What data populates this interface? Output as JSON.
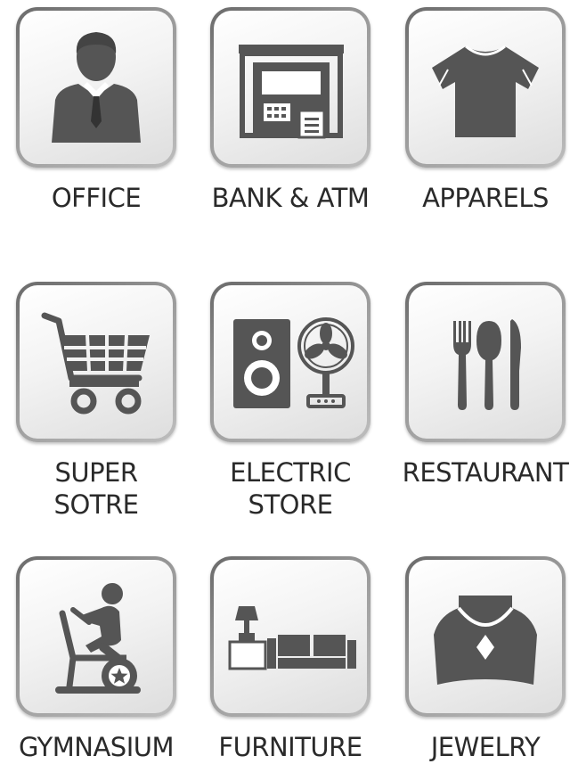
{
  "icons": [
    {
      "label": "OFFICE",
      "icon": "businessman-icon"
    },
    {
      "label": "BANK & ATM",
      "icon": "atm-icon"
    },
    {
      "label": "APPARELS",
      "icon": "tshirt-icon"
    },
    {
      "label_lines": [
        "SUPER",
        "SOTRE"
      ],
      "icon": "shopping-cart-icon"
    },
    {
      "label_lines": [
        "ELECTRIC",
        "STORE"
      ],
      "icon": "speaker-fan-icon"
    },
    {
      "label": "RESTAURANT",
      "icon": "cutlery-icon"
    },
    {
      "label": "GYMNASIUM",
      "icon": "exercise-bike-icon"
    },
    {
      "label": "FURNITURE",
      "icon": "sofa-lamp-icon"
    },
    {
      "label": "JEWELRY",
      "icon": "necklace-icon"
    }
  ],
  "colors": {
    "icon": "#555555",
    "text": "#2a2a2a",
    "tile_border": "#8c8c8c"
  }
}
